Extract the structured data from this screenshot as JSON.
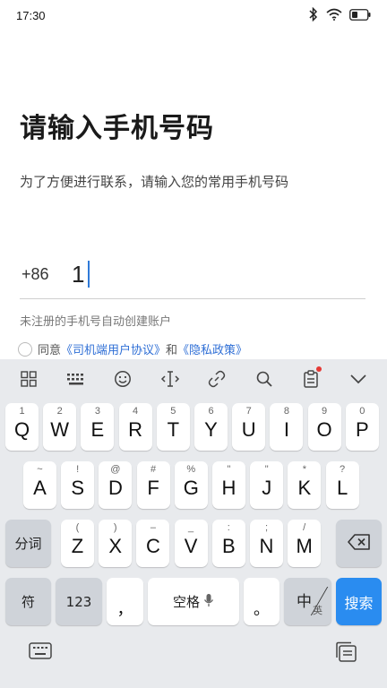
{
  "status_bar": {
    "time": "17:30",
    "icons": [
      "bluetooth-icon",
      "wifi-icon",
      "battery-icon"
    ]
  },
  "page": {
    "title": "请输入手机号码",
    "subtitle": "为了方便进行联系，请输入您的常用手机号码",
    "country_code": "+86",
    "phone_value": "1",
    "hint": "未注册的手机号自动创建账户",
    "agree_prefix": "同意",
    "agreement_link": "《司机端用户协议》",
    "agree_and": "和",
    "privacy_link": "《隐私政策》",
    "accent_color": "#2f6fd6"
  },
  "keyboard": {
    "toolbar": [
      "grid-icon",
      "keyboard-layout-icon",
      "emoji-icon",
      "cursor-icon",
      "clipboard-link-icon",
      "search-icon",
      "clipboard-icon",
      "collapse-chevron-icon"
    ],
    "row1": [
      {
        "main": "Q",
        "sub": "1"
      },
      {
        "main": "W",
        "sub": "2"
      },
      {
        "main": "E",
        "sub": "3"
      },
      {
        "main": "R",
        "sub": "4"
      },
      {
        "main": "T",
        "sub": "5"
      },
      {
        "main": "Y",
        "sub": "6"
      },
      {
        "main": "U",
        "sub": "7"
      },
      {
        "main": "I",
        "sub": "8"
      },
      {
        "main": "O",
        "sub": "9"
      },
      {
        "main": "P",
        "sub": "0"
      }
    ],
    "row2": [
      {
        "main": "A",
        "sub": "~"
      },
      {
        "main": "S",
        "sub": "!"
      },
      {
        "main": "D",
        "sub": "@"
      },
      {
        "main": "F",
        "sub": "#"
      },
      {
        "main": "G",
        "sub": "%"
      },
      {
        "main": "H",
        "sub": "\""
      },
      {
        "main": "J",
        "sub": "\""
      },
      {
        "main": "K",
        "sub": "*"
      },
      {
        "main": "L",
        "sub": "?"
      }
    ],
    "row3": [
      {
        "main": "Z",
        "sub": "("
      },
      {
        "main": "X",
        "sub": ")"
      },
      {
        "main": "C",
        "sub": "–"
      },
      {
        "main": "V",
        "sub": "_"
      },
      {
        "main": "B",
        "sub": ":"
      },
      {
        "main": "N",
        "sub": ";"
      },
      {
        "main": "M",
        "sub": "/"
      }
    ],
    "fenci_label": "分词",
    "symbol_label": "符",
    "num_label": "123",
    "comma_label": "，",
    "space_label": "空格",
    "period_label": "。",
    "lang_zh": "中",
    "lang_en": "英",
    "search_label": "搜索",
    "search_color": "#2a8cf0"
  }
}
